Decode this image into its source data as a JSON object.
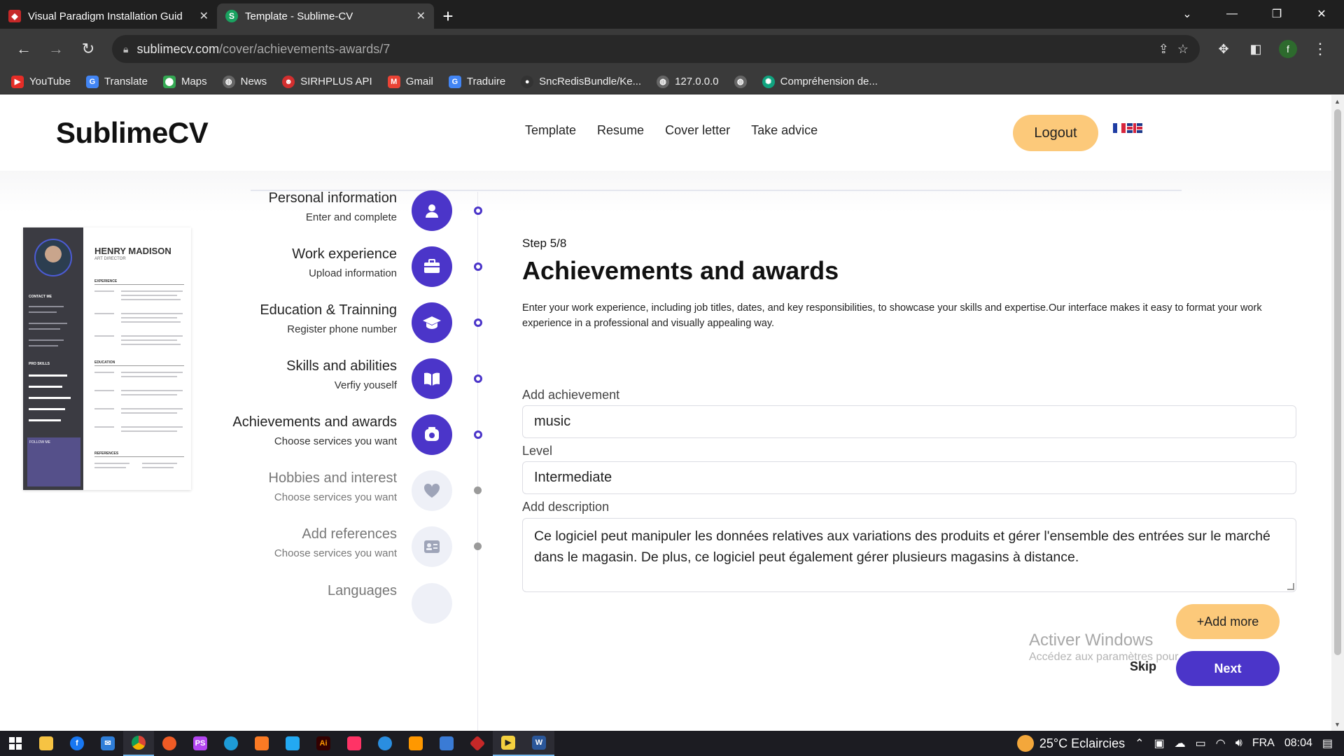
{
  "browser": {
    "tabs": [
      {
        "title": "Visual Paradigm Installation Guid",
        "favicon_color": "#c62828",
        "active": false
      },
      {
        "title": "Template - Sublime-CV",
        "favicon_color": "#1aa260",
        "favicon_letter": "S",
        "active": true
      }
    ],
    "new_tab": "+",
    "url_host": "sublimecv.com",
    "url_path": "/cover/achievements-awards/7",
    "profile_letter": "f",
    "bookmarks": [
      {
        "label": "YouTube",
        "color": "#e52d27"
      },
      {
        "label": "Translate",
        "color": "#4285f4"
      },
      {
        "label": "Maps",
        "color": "#34a853"
      },
      {
        "label": "News",
        "color": "#888888"
      },
      {
        "label": "SIRHPLUS API",
        "color": "#d32f2f"
      },
      {
        "label": "Gmail",
        "color": "#ea4335"
      },
      {
        "label": "Traduire",
        "color": "#4285f4"
      },
      {
        "label": "SncRedisBundle/Ke...",
        "color": "#333333"
      },
      {
        "label": "127.0.0.0",
        "color": "#888888"
      },
      {
        "label": "",
        "color": "#888888"
      },
      {
        "label": "Compréhension de...",
        "color": "#10a37f"
      }
    ]
  },
  "site": {
    "logo": "SublimeCV",
    "nav": [
      "Template",
      "Resume",
      "Cover letter",
      "Take advice"
    ],
    "logout": "Logout",
    "accent": "#4b35c9",
    "button_yellow": "#fcc97a"
  },
  "cv_preview": {
    "name": "HENRY MADISON",
    "role": "ART DIRECTOR",
    "sections": [
      "EXPERIENCE",
      "EDUCATION",
      "REFERENCES"
    ],
    "side_sections": [
      "CONTACT ME",
      "PRO SKILLS",
      "FOLLOW ME"
    ]
  },
  "steps": [
    {
      "title": "Personal information",
      "sub": "Enter and complete",
      "icon": "user-icon",
      "active": true
    },
    {
      "title": "Work experience",
      "sub": "Upload information",
      "icon": "briefcase-icon",
      "active": true
    },
    {
      "title": "Education & Trainning",
      "sub": "Register phone number",
      "icon": "graduation-cap-icon",
      "active": true
    },
    {
      "title": "Skills and abilities",
      "sub": "Verfiy youself",
      "icon": "book-icon",
      "active": true
    },
    {
      "title": "Achievements and awards",
      "sub": "Choose services you want",
      "icon": "award-icon",
      "active": true
    },
    {
      "title": "Hobbies and interest",
      "sub": "Choose services you want",
      "icon": "heart-icon",
      "active": false
    },
    {
      "title": "Add references",
      "sub": "Choose services you want",
      "icon": "id-card-icon",
      "active": false
    },
    {
      "title": "Languages",
      "sub": "",
      "icon": "globe-icon",
      "active": false
    }
  ],
  "form": {
    "step": "Step 5/8",
    "title": "Achievements and awards",
    "description": "Enter your work experience, including job titles, dates, and key responsibilities, to showcase your skills and expertise.Our interface makes it easy to format your work experience in a professional and visually appealing way.",
    "achievement_label": "Add achievement",
    "achievement_value": "music",
    "level_label": "Level",
    "level_value": "Intermediate",
    "description_label": "Add description",
    "description_value": "Ce logiciel peut manipuler les données relatives aux variations des produits et gérer l'ensemble des entrées sur le marché dans le magasin. De plus, ce logiciel peut également gérer plusieurs magasins à distance.",
    "add_more": "+Add more",
    "skip": "Skip",
    "next": "Next"
  },
  "watermark": {
    "line1": "Activer Windows",
    "line2": "Accédez aux paramètres pour activer Windows."
  },
  "taskbar": {
    "weather": "25°C Eclaircies",
    "lang": "FRA",
    "time": "08:04",
    "apps": [
      {
        "name": "file-explorer-icon",
        "color": "#f6c343"
      },
      {
        "name": "facebook-icon",
        "color": "#1877f2"
      },
      {
        "name": "mail-icon",
        "color": "#2f7ed8"
      },
      {
        "name": "chrome-icon",
        "color": "#e3a21a",
        "open": true
      },
      {
        "name": "postman-icon",
        "color": "#ef5b25"
      },
      {
        "name": "phpstorm-icon",
        "color": "#b345f1"
      },
      {
        "name": "edge-icon",
        "color": "#1e9bd7"
      },
      {
        "name": "xampp-icon",
        "color": "#fb7a24"
      },
      {
        "name": "vscode-icon",
        "color": "#23a9f2"
      },
      {
        "name": "illustrator-icon",
        "color": "#330000"
      },
      {
        "name": "indesign-icon",
        "color": "#ff3366"
      },
      {
        "name": "app-icon",
        "color": "#2a8ee0"
      },
      {
        "name": "sublime-icon",
        "color": "#ff9800"
      },
      {
        "name": "terminal-icon",
        "color": "#3a7bd5"
      },
      {
        "name": "visual-paradigm-icon",
        "color": "#c62828"
      },
      {
        "name": "media-icon",
        "color": "#f4d03f",
        "open": true
      },
      {
        "name": "word-icon",
        "color": "#2b579a",
        "open": true
      }
    ]
  }
}
